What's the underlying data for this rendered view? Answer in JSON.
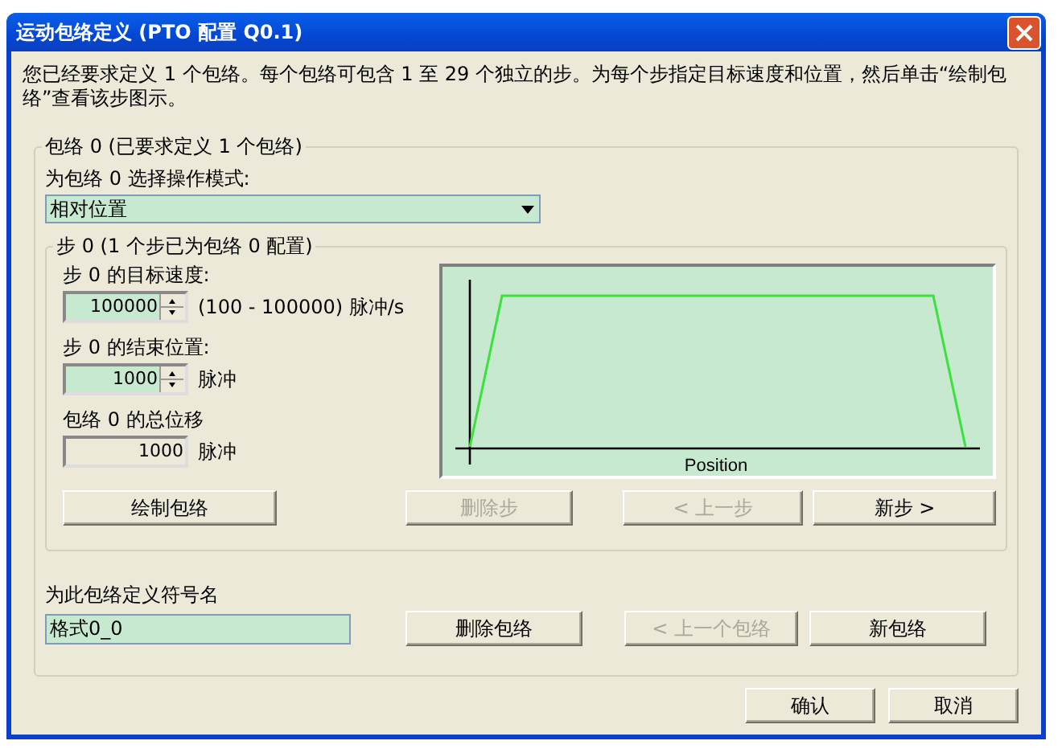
{
  "window": {
    "title": "运动包络定义 (PTO 配置 Q0.1)"
  },
  "intro": "您已经要求定义 1 个包络。每个包络可包含 1 至 29 个独立的步。为每个步指定目标速度和位置，然后单击“绘制包络”查看该步图示。",
  "profile_group": {
    "legend": "包络 0 (已要求定义 1 个包络)",
    "mode_label": "为包络 0 选择操作模式:",
    "mode_value": "相对位置",
    "step_group": {
      "legend": "步 0 (1 个步已为包络 0 配置)",
      "fields": [
        {
          "kind": "spinner",
          "label": "步 0 的目标速度:",
          "value": "100000",
          "unit": "(100 - 100000) 脉冲/s"
        },
        {
          "kind": "spinner",
          "label": "步 0 的结束位置:",
          "value": "1000",
          "unit": "脉冲"
        },
        {
          "kind": "readonly",
          "label": "包络 0 的总位移",
          "value": "1000",
          "unit": "脉冲"
        }
      ],
      "chart": {
        "xlabel": "Position"
      },
      "buttons": [
        {
          "label": "绘制包络",
          "disabled": false
        },
        {
          "label": "删除步",
          "disabled": true
        },
        {
          "label": "< 上一步",
          "disabled": true
        },
        {
          "label": "新步 >",
          "disabled": false
        }
      ]
    },
    "name_label": "为此包络定义符号名",
    "name_value": "格式0_0",
    "buttons": [
      {
        "label": "删除包络",
        "disabled": false
      },
      {
        "label": "< 上一个包络",
        "disabled": true
      },
      {
        "label": "新包络",
        "disabled": false
      }
    ]
  },
  "dialog_buttons": [
    {
      "label": "确认"
    },
    {
      "label": "取消"
    }
  ]
}
